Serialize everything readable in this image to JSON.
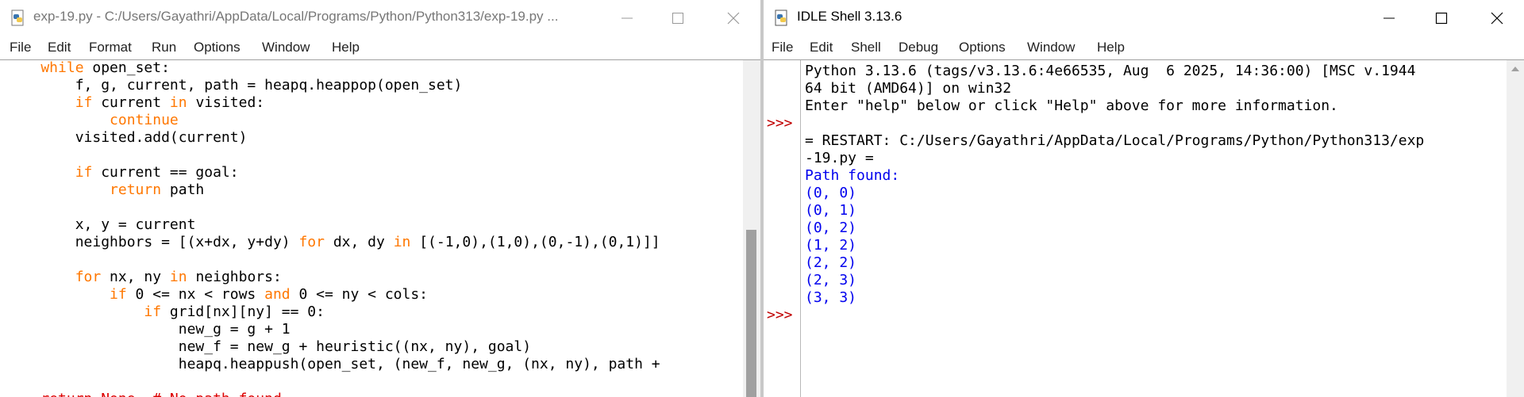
{
  "editor": {
    "title": "exp-19.py - C:/Users/Gayathri/AppData/Local/Programs/Python/Python313/exp-19.py ...",
    "menu": [
      "File",
      "Edit",
      "Format",
      "Run",
      "Options",
      "Window",
      "Help"
    ],
    "code_lines": [
      [
        [
          "kw",
          "    while"
        ],
        [
          "plain",
          " open_set:"
        ]
      ],
      [
        [
          "plain",
          "        f, g, current, path = heapq.heappop(open_set)"
        ]
      ],
      [
        [
          "kw",
          "        if"
        ],
        [
          "plain",
          " current "
        ],
        [
          "kw",
          "in"
        ],
        [
          "plain",
          " visited:"
        ]
      ],
      [
        [
          "kw",
          "            continue"
        ]
      ],
      [
        [
          "plain",
          "        visited.add(current)"
        ]
      ],
      [
        [
          "plain",
          ""
        ]
      ],
      [
        [
          "kw",
          "        if"
        ],
        [
          "plain",
          " current == goal:"
        ]
      ],
      [
        [
          "kw",
          "            return"
        ],
        [
          "plain",
          " path"
        ]
      ],
      [
        [
          "plain",
          ""
        ]
      ],
      [
        [
          "plain",
          "        x, y = current"
        ]
      ],
      [
        [
          "plain",
          "        neighbors = [(x+dx, y+dy) "
        ],
        [
          "kw",
          "for"
        ],
        [
          "plain",
          " dx, dy "
        ],
        [
          "kw",
          "in"
        ],
        [
          "plain",
          " [(-1,0),(1,0),(0,-1),(0,1)]]"
        ]
      ],
      [
        [
          "plain",
          ""
        ]
      ],
      [
        [
          "kw",
          "        for"
        ],
        [
          "plain",
          " nx, ny "
        ],
        [
          "kw",
          "in"
        ],
        [
          "plain",
          " neighbors:"
        ]
      ],
      [
        [
          "kw",
          "            if"
        ],
        [
          "plain",
          " 0 <= nx < rows "
        ],
        [
          "kw",
          "and"
        ],
        [
          "plain",
          " 0 <= ny < cols:"
        ]
      ],
      [
        [
          "kw",
          "                if"
        ],
        [
          "plain",
          " grid[nx][ny] == 0:"
        ]
      ],
      [
        [
          "plain",
          "                    new_g = g + 1"
        ]
      ],
      [
        [
          "plain",
          "                    new_f = new_g + heuristic((nx, ny), goal)"
        ]
      ],
      [
        [
          "plain",
          "                    heapq.heappush(open_set, (new_f, new_g, (nx, ny), path +"
        ]
      ],
      [
        [
          "plain",
          ""
        ]
      ],
      [
        [
          "cm",
          "    return None  # No path found"
        ]
      ]
    ]
  },
  "shell": {
    "title": "IDLE Shell 3.13.6",
    "menu": [
      "File",
      "Edit",
      "Shell",
      "Debug",
      "Options",
      "Window",
      "Help"
    ],
    "prompt_symbol": ">>>",
    "lines": [
      {
        "text": "Python 3.13.6 (tags/v3.13.6:4e66535, Aug  6 2025, 14:36:00) [MSC v.1944",
        "style": "plain",
        "prompt": false
      },
      {
        "text": "64 bit (AMD64)] on win32",
        "style": "plain",
        "prompt": false
      },
      {
        "text": "Enter \"help\" below or click \"Help\" above for more information.",
        "style": "plain",
        "prompt": false
      },
      {
        "text": "",
        "style": "plain",
        "prompt": true
      },
      {
        "text": "= RESTART: C:/Users/Gayathri/AppData/Local/Programs/Python/Python313/exp",
        "style": "plain",
        "prompt": false
      },
      {
        "text": "-19.py =",
        "style": "plain",
        "prompt": false
      },
      {
        "text": "Path found:",
        "style": "out",
        "prompt": false
      },
      {
        "text": "(0, 0)",
        "style": "out",
        "prompt": false
      },
      {
        "text": "(0, 1)",
        "style": "out",
        "prompt": false
      },
      {
        "text": "(0, 2)",
        "style": "out",
        "prompt": false
      },
      {
        "text": "(1, 2)",
        "style": "out",
        "prompt": false
      },
      {
        "text": "(2, 2)",
        "style": "out",
        "prompt": false
      },
      {
        "text": "(2, 3)",
        "style": "out",
        "prompt": false
      },
      {
        "text": "(3, 3)",
        "style": "out",
        "prompt": false
      },
      {
        "text": "",
        "style": "plain",
        "prompt": true
      }
    ]
  },
  "colors": {
    "keyword": "#ff7700",
    "comment": "#dd0000",
    "output": "#0000ee",
    "prompt": "#c00000"
  },
  "icons": [
    "python-file-icon",
    "minimize-icon",
    "maximize-icon",
    "close-icon",
    "scroll-up-arrow-icon"
  ]
}
